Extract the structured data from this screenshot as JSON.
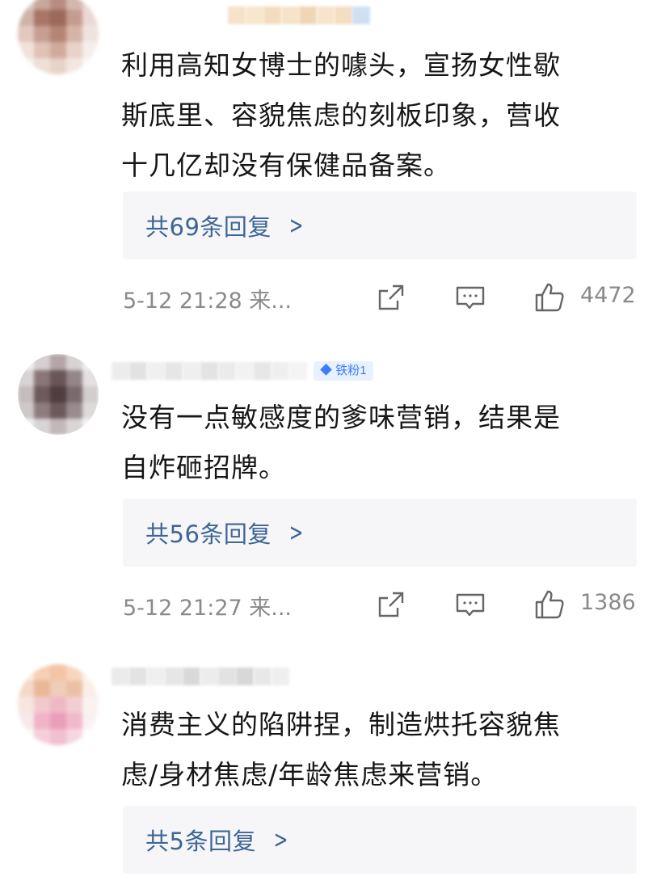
{
  "comments": [
    {
      "text_lines": [
        "利用高知女博士的噱头，宣扬女性歇",
        "斯底里、容貌焦虑的刻板印象，营收",
        "十几亿却没有保健品备案。"
      ],
      "replies_label": "共69条回复",
      "time": "5-12 21:28 来...",
      "likes": "4472",
      "badge": ""
    },
    {
      "text_lines": [
        "没有一点敏感度的爹味营销，结果是",
        "自炸砸招牌。"
      ],
      "replies_label": "共56条回复",
      "time": "5-12 21:27 来...",
      "likes": "1386",
      "badge": "铁粉1"
    },
    {
      "text_lines": [
        "消费主义的陷阱捏，制造烘托容貌焦",
        "虑/身材焦虑/年龄焦虑来营销。"
      ],
      "replies_label": "共5条回复",
      "time": "",
      "likes": "",
      "badge": ""
    }
  ],
  "icons": {
    "share": "share-icon",
    "comment": "comment-icon",
    "like": "like-icon",
    "chevron": "chevron-right-icon"
  },
  "colors": {
    "reply_link": "#3d6596",
    "meta_text": "#8a8a8a",
    "reply_bg": "#f6f6f8",
    "badge_bg": "#e8f1ff",
    "badge_text": "#3b7dff"
  }
}
